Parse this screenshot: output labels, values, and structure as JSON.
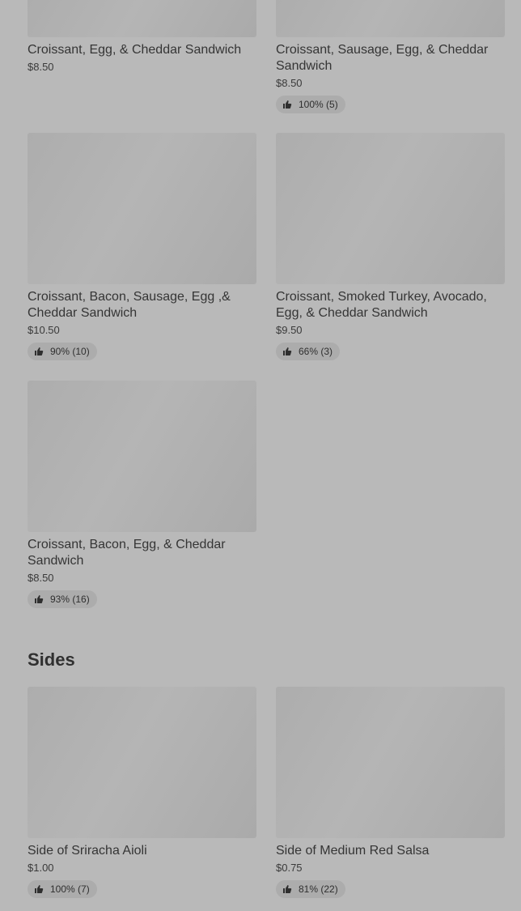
{
  "items": [
    {
      "name": "Croissant, Egg, & Cheddar Sandwich",
      "price": "$8.50",
      "rating": ""
    },
    {
      "name": "Croissant, Sausage, Egg, & Cheddar Sandwich",
      "price": "$8.50",
      "rating": "100% (5)"
    },
    {
      "name": "Croissant, Bacon, Sausage, Egg ,& Cheddar Sandwich",
      "price": "$10.50",
      "rating": "90% (10)"
    },
    {
      "name": "Croissant, Smoked Turkey, Avocado, Egg, & Cheddar Sandwich",
      "price": "$9.50",
      "rating": "66% (3)"
    },
    {
      "name": "Croissant, Bacon, Egg, & Cheddar Sandwich",
      "price": "$8.50",
      "rating": "93% (16)"
    }
  ],
  "sides": {
    "title": "Sides",
    "items": [
      {
        "name": "Side of Sriracha Aioli",
        "price": "$1.00",
        "rating": "100% (7)"
      },
      {
        "name": "Side of Medium Red Salsa",
        "price": "$0.75",
        "rating": "81% (22)"
      }
    ]
  },
  "icons": {
    "rating": "thumbs-up-icon"
  },
  "colors": {
    "background": "#b9b9b9",
    "placeholder": "#adadad",
    "badge": "#acacac"
  }
}
